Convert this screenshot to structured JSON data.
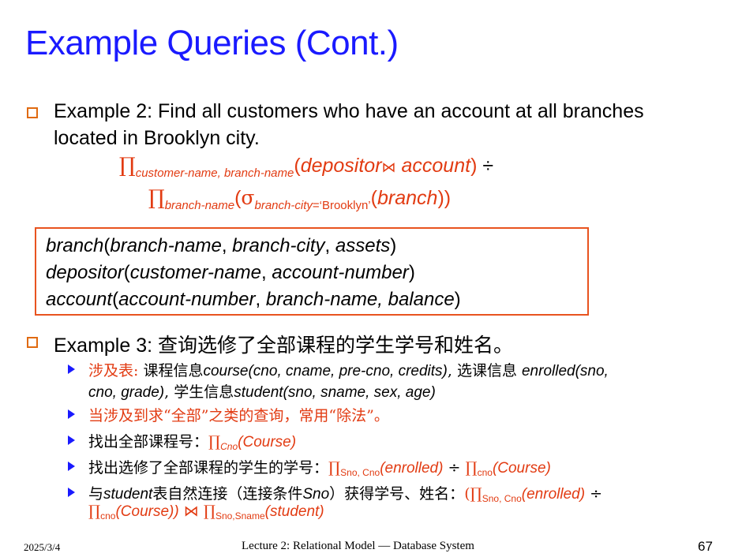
{
  "slide": {
    "title": "Example Queries (Cont.)",
    "footer_date": "2025/3/4",
    "footer_center": "Lecture 2: Relational Model — Database System",
    "page_number": "67"
  },
  "example2": {
    "line1": "Example 2: Find all customers who have an account at all branches",
    "line2": "located in Brooklyn city.",
    "f1_pi": "∏",
    "f1_sub": "customer-name, branch-name",
    "f1_open": "(",
    "f1_rel1": "depositor",
    "f1_join": "⋈",
    "f1_rel2": "account",
    "f1_close": ")",
    "f1_div": "÷",
    "f2_pi": "∏",
    "f2_sub": "branch-name",
    "f2_open": "(",
    "f2_sigma": "σ",
    "f2_sel": "branch-city",
    "f2_eq": "=‘Brooklyn’",
    "f2_open2": "(",
    "f2_rel": "branch",
    "f2_close": "))"
  },
  "schema": {
    "r1_name": "branch",
    "r1_open": "(",
    "r1_a": "branch-name",
    "r1_c1": ", ",
    "r1_b": "branch-city",
    "r1_c2": ", ",
    "r1_c": "assets",
    "r1_close": ")",
    "r2_name": "depositor",
    "r2_open": "(",
    "r2_a": "customer-name",
    "r2_c1": ", ",
    "r2_b": "account-number",
    "r2_close": ")",
    "r3_name": "account",
    "r3_open": "(",
    "r3_a": "account-number",
    "r3_c1": ", ",
    "r3_b": "branch-name, balance",
    "r3_close": ")"
  },
  "example3": {
    "line": "Example 3: 查询选修了全部课程的学生学号和姓名。",
    "s1_label": "涉及表:",
    "s1_a": " 课程信息",
    "s1_course": "course",
    "s1_args1": "(cno, cname, pre-cno, credits)",
    "s1_b": ", 选课信息 ",
    "s1_enrolled": "enrolled",
    "s1_args2": "(sno,",
    "s1_line2a": "cno, grade)",
    "s1_c": ", 学生信息",
    "s1_student": "student",
    "s1_args3": "(sno, sname, sex, age)",
    "s2": "当涉及到求“全部”之类的查询，常用“除法”。",
    "s3_text": "找出全部课程号：",
    "s3_pi": "∏",
    "s3_sub": "Cno",
    "s3_rest": "(Course)",
    "s4_text": "找出选修了全部课程的学生的学号：",
    "s4_pi1": "∏",
    "s4_sub1": "Sno, Cno",
    "s4_rest1": "(enrolled)",
    "s4_div": " ÷ ",
    "s4_pi2": "∏",
    "s4_sub2": "cno",
    "s4_rest2": "(Course)",
    "s5_a": "与",
    "s5_student": "student",
    "s5_b": "表自然连接（连接条件",
    "s5_sno": "Sno",
    "s5_c": "）获得学号、姓名：",
    "s5_f1": "(∏",
    "s5_sub1": "Sno, Cno",
    "s5_f1b": "(enrolled)",
    "s5_div": " ÷",
    "s5_l2_pi": "∏",
    "s5_l2_sub": "cno",
    "s5_l2_a": "(Course))",
    "s5_l2_join": " ⋈ ",
    "s5_l2_pi2": "∏",
    "s5_l2_sub2": "Sno,Sname",
    "s5_l2_b": "(student)"
  },
  "colors": {
    "title": "#1a1aff",
    "accent": "#e23b12",
    "bullet": "#e06a10"
  }
}
